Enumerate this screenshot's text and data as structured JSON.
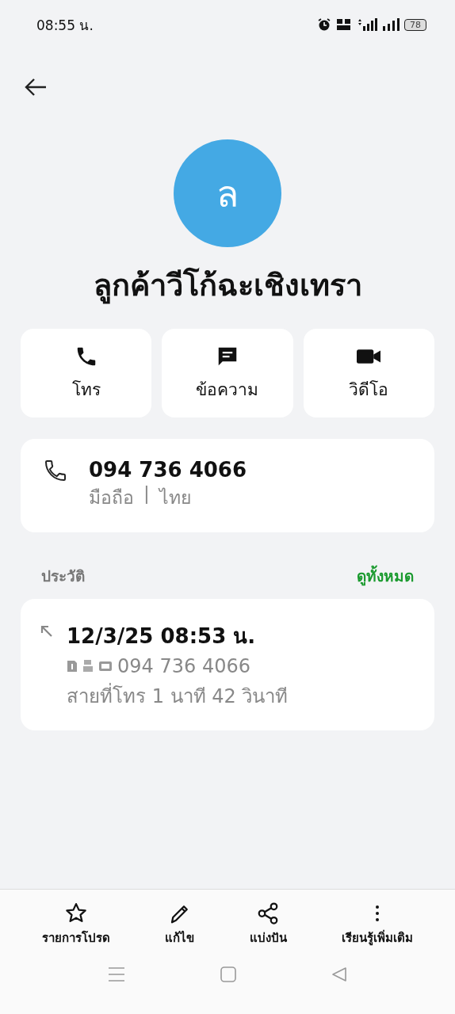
{
  "status_bar": {
    "time": "08:55 น.",
    "battery": "78"
  },
  "contact": {
    "initial": "ล",
    "name": "ลูกค้าวีโก้ฉะเชิงเทรา"
  },
  "actions": [
    {
      "kind": "call",
      "label": "โทร"
    },
    {
      "kind": "message",
      "label": "ข้อความ"
    },
    {
      "kind": "video",
      "label": "วิดีโอ"
    }
  ],
  "phone": {
    "number": "094 736 4066",
    "type": "มือถือ",
    "separator": "|",
    "country": "ไทย"
  },
  "history": {
    "title": "ประวัติ",
    "see_all": "ดูทั้งหมด",
    "entries": [
      {
        "datetime": "12/3/25 08:53 น.",
        "number": "094 736 4066",
        "duration": "สายที่โทร  1 นาที 42 วินาที"
      }
    ]
  },
  "bottom_bar": [
    {
      "kind": "star",
      "label": "รายการโปรด"
    },
    {
      "kind": "edit",
      "label": "แก้ไข"
    },
    {
      "kind": "share",
      "label": "แบ่งปัน"
    },
    {
      "kind": "more",
      "label": "เรียนรู้เพิ่มเติม"
    }
  ]
}
